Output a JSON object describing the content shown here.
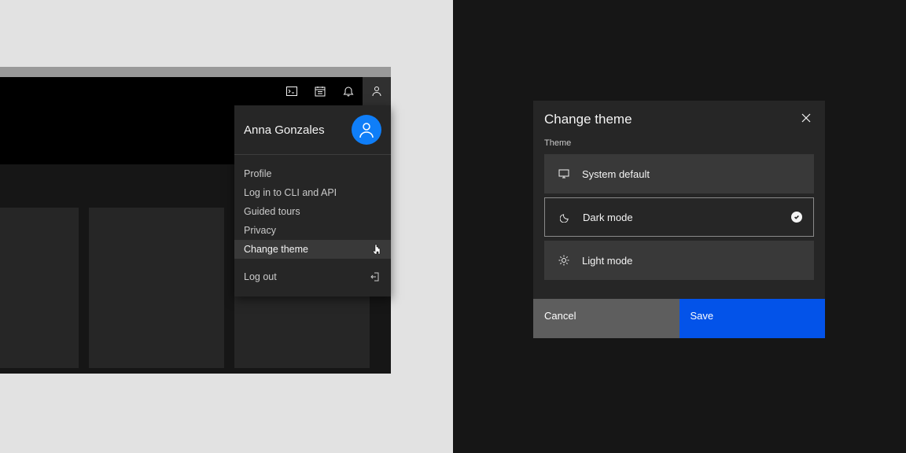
{
  "profile": {
    "name": "Anna Gonzales",
    "menu": {
      "profile": "Profile",
      "login_cli": "Log in to CLI and API",
      "guided_tours": "Guided tours",
      "privacy": "Privacy",
      "change_theme": "Change theme",
      "logout": "Log out"
    }
  },
  "modal": {
    "title": "Change theme",
    "section_label": "Theme",
    "options": {
      "system": "System default",
      "dark": "Dark mode",
      "light": "Light mode"
    },
    "cancel": "Cancel",
    "save": "Save"
  }
}
